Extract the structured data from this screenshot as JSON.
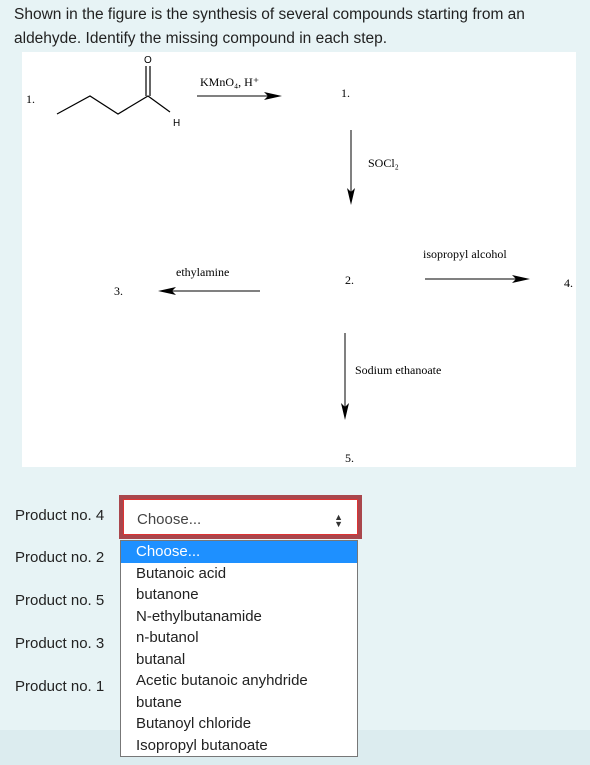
{
  "question": "Shown in the figure is the synthesis of several compounds starting from an aldehyde. Identify the missing compound in each step.",
  "figure": {
    "labels": [
      "1.",
      "1.",
      "2.",
      "3.",
      "4.",
      "5."
    ],
    "atoms": {
      "O": "O",
      "H": "H"
    },
    "reagents": {
      "kmno4": "KMnO₄, H⁺",
      "socl2": "SOCl₂",
      "ethylamine": "ethylamine",
      "isopropyl": "isopropyl alcohol",
      "sodium": "Sodium ethanoate"
    }
  },
  "products": [
    "Product no. 4",
    "Product no. 2",
    "Product no. 5",
    "Product no. 3",
    "Product no. 1"
  ],
  "select": {
    "value": "Choose...",
    "options": [
      "Choose...",
      "Butanoic acid",
      "butanone",
      "N-ethylbutanamide",
      "n-butanol",
      "butanal",
      "Acetic butanoic anyhdride",
      "butane",
      "Butanoyl chloride",
      "Isopropyl butanoate"
    ]
  }
}
